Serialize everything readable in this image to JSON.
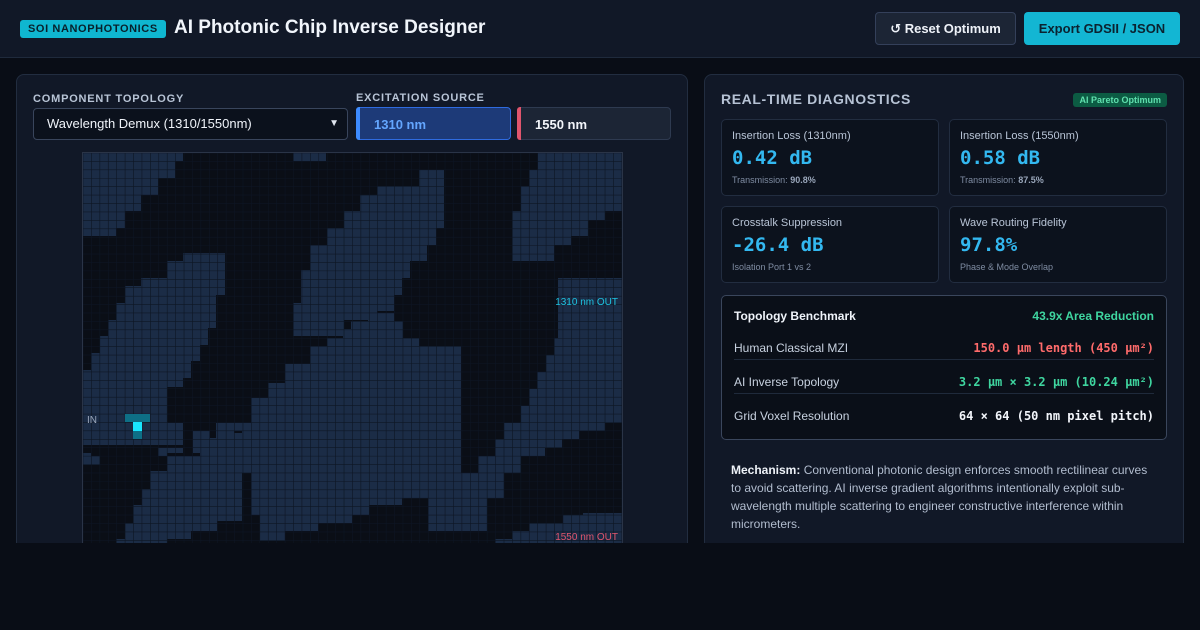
{
  "header": {
    "badge": "SOI NANOPHOTONICS",
    "title": "AI Photonic Chip Inverse Designer",
    "reset_label": "↺ Reset Optimum",
    "export_label": "Export GDSII / JSON"
  },
  "left": {
    "topology_label": "COMPONENT TOPOLOGY",
    "topology_value": "Wavelength Demux (1310/1550nm)",
    "source_label": "EXCITATION SOURCE",
    "source_options": [
      "1310 nm",
      "1550 nm"
    ],
    "ports": {
      "in": "IN",
      "out1": "1310 nm OUT",
      "out2": "1550 nm OUT"
    },
    "voxel_color": "#1b2c46",
    "source_color": "#19e6ff"
  },
  "right": {
    "title": "REAL-TIME DIAGNOSTICS",
    "pareto_badge": "AI Pareto Optimum",
    "cards": [
      {
        "label": "Insertion Loss (1310nm)",
        "value": "0.42 dB",
        "sub_prefix": "Transmission: ",
        "sub_value": "90.8%"
      },
      {
        "label": "Insertion Loss (1550nm)",
        "value": "0.58 dB",
        "sub_prefix": "Transmission: ",
        "sub_value": "87.5%"
      },
      {
        "label": "Crosstalk Suppression",
        "value": "-26.4 dB",
        "sub_prefix": "Isolation Port 1 vs 2",
        "sub_value": ""
      },
      {
        "label": "Wave Routing Fidelity",
        "value": "97.8%",
        "sub_prefix": "Phase & Mode Overlap",
        "sub_value": ""
      }
    ],
    "benchmark": {
      "title": "Topology Benchmark",
      "reduction": "43.9x Area Reduction",
      "rows": [
        {
          "key": "Human Classical MZI",
          "value": "150.0 µm length (450 µm²)"
        },
        {
          "key": "AI Inverse Topology",
          "value": "3.2 µm × 3.2 µm (10.24 µm²)"
        },
        {
          "key": "Grid Voxel Resolution",
          "value": "64 × 64 (50 nm pixel pitch)"
        }
      ]
    },
    "mechanism_label": "Mechanism:",
    "mechanism_text": "Conventional photonic design enforces smooth rectilinear curves to avoid scattering. AI inverse gradient algorithms intentionally exploit sub-wavelength multiple scattering to engineer constructive interference within micrometers."
  }
}
